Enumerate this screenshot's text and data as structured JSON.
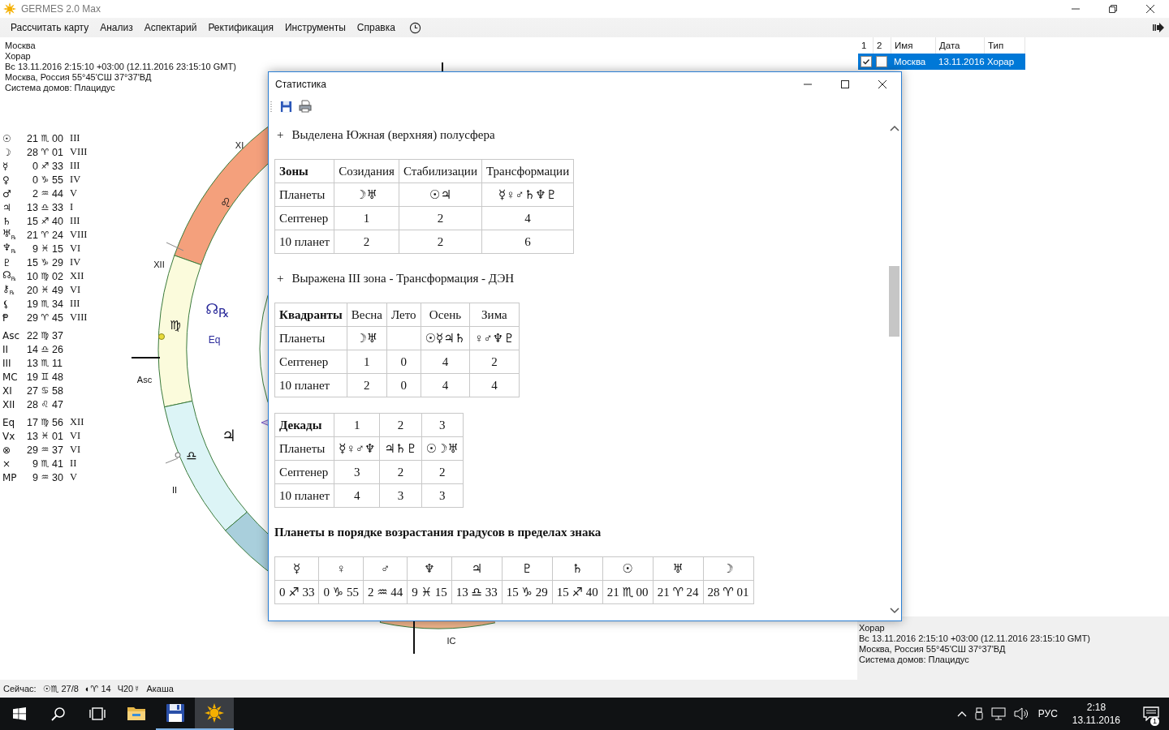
{
  "window": {
    "title": "GERMES 2.0 Max"
  },
  "menu": [
    "Рассчитать карту",
    "Анализ",
    "Аспектарий",
    "Ректификация",
    "Инструменты",
    "Справка"
  ],
  "chart_info": [
    "Москва",
    "Хорар",
    "Вс 13.11.2016 2:15:10 +03:00 (12.11.2016 23:15:10 GMT)",
    "Москва, Россия 55°45'СШ 37°37'ВД",
    "Система домов: Плацидус"
  ],
  "positions": [
    [
      {
        "glyph": "☉",
        "deg": "21",
        "sign": "♏",
        "min": "00",
        "house": "III"
      },
      {
        "glyph": "☽",
        "deg": "28",
        "sign": "♈",
        "min": "01",
        "house": "VIII"
      },
      {
        "glyph": "☿",
        "deg": "0",
        "sign": "♐",
        "min": "33",
        "house": "III"
      },
      {
        "glyph": "♀",
        "deg": "0",
        "sign": "♑",
        "min": "55",
        "house": "IV"
      },
      {
        "glyph": "♂",
        "deg": "2",
        "sign": "♒",
        "min": "44",
        "house": "V"
      },
      {
        "glyph": "♃",
        "deg": "13",
        "sign": "♎",
        "min": "33",
        "house": "I"
      },
      {
        "glyph": "♄",
        "deg": "15",
        "sign": "♐",
        "min": "40",
        "house": "III"
      },
      {
        "glyph": "♅$_{℞}$",
        "deg": "21",
        "sign": "♈",
        "min": "24",
        "house": "VIII"
      },
      {
        "glyph": "♆$_{℞}$",
        "deg": "9",
        "sign": "♓",
        "min": "15",
        "house": "VI"
      },
      {
        "glyph": "♇",
        "deg": "15",
        "sign": "♑",
        "min": "29",
        "house": "IV"
      },
      {
        "glyph": "☊$_{℞}$",
        "deg": "10",
        "sign": "♍",
        "min": "02",
        "house": "XII"
      },
      {
        "glyph": "⚷$_{℞}$",
        "deg": "20",
        "sign": "♓",
        "min": "49",
        "house": "VI"
      },
      {
        "glyph": "⚸",
        "deg": "19",
        "sign": "♏",
        "min": "34",
        "house": "III"
      },
      {
        "glyph": "Ᵽ",
        "deg": "29",
        "sign": "♈",
        "min": "45",
        "house": "VIII"
      }
    ],
    [
      {
        "glyph": "Asc",
        "deg": "22",
        "sign": "♍",
        "min": "37"
      },
      {
        "glyph": "II",
        "deg": "14",
        "sign": "♎",
        "min": "26"
      },
      {
        "glyph": "III",
        "deg": "13",
        "sign": "♏",
        "min": "11"
      },
      {
        "glyph": "MC",
        "deg": "19",
        "sign": "♊",
        "min": "48"
      },
      {
        "glyph": "XI",
        "deg": "27",
        "sign": "♋",
        "min": "58"
      },
      {
        "glyph": "XII",
        "deg": "28",
        "sign": "♌",
        "min": "47"
      }
    ],
    [
      {
        "glyph": "Eq",
        "deg": "17",
        "sign": "♍",
        "min": "56",
        "house": "XII"
      },
      {
        "glyph": "Vx",
        "deg": "13",
        "sign": "♓",
        "min": "01",
        "house": "VI"
      },
      {
        "glyph": "⊗",
        "deg": "29",
        "sign": "♒",
        "min": "37",
        "house": "VI"
      },
      {
        "glyph": "×",
        "deg": "9",
        "sign": "♏",
        "min": "41",
        "house": "II"
      },
      {
        "glyph": "MP",
        "deg": "9",
        "sign": "♒",
        "min": "30",
        "house": "V"
      }
    ]
  ],
  "chart_labels": [
    "XI",
    "XII",
    "Asc",
    "II",
    "IC",
    "♌",
    "♍",
    "♎",
    "☊$_{℞}$",
    "Eq",
    "♃"
  ],
  "charts_table": {
    "columns": [
      "1",
      "2",
      "Имя",
      "Дата",
      "Тип"
    ],
    "rows": [
      {
        "first": true,
        "second": false,
        "name": "Москва",
        "date": "13.11.2016",
        "type": "Хорар",
        "selected": true
      }
    ]
  },
  "details": [
    "Хорар",
    "Вс 13.11.2016 2:15:10 +03:00 (12.11.2016 23:15:10 GMT)",
    "Москва, Россия 55°45'СШ 37°37'ВД",
    "Система домов: Плацидус"
  ],
  "status_bar": {
    "label": "Сейчас:",
    "items": [
      "☉♏ 27/8",
      "◐♈ 14",
      "Ч20☿",
      "Акаша"
    ]
  },
  "dialog": {
    "title": "Статистика",
    "blocks": [
      {
        "kind": "note",
        "marker": "+",
        "text": "Выделена Южная (верхняя) полусфера"
      },
      {
        "kind": "table",
        "header": true,
        "rows": [
          [
            "Зоны",
            "Созидания",
            "Стабилизации",
            "Трансформации"
          ],
          [
            "Планеты",
            "☽♅",
            "☉♃",
            "☿♀♂♄♆♇"
          ],
          [
            "Септенер",
            "1",
            "2",
            "4"
          ],
          [
            "10 планет",
            "2",
            "2",
            "6"
          ]
        ]
      },
      {
        "kind": "note",
        "marker": "+",
        "text": "Выражена III зона - Трансформация - ДЭН"
      },
      {
        "kind": "table",
        "header": true,
        "rows": [
          [
            "Квадранты",
            "Весна",
            "Лето",
            "Осень",
            "Зима"
          ],
          [
            "Планеты",
            "☽♅",
            null,
            "☉☿♃♄",
            "♀♂♆♇"
          ],
          [
            "Септенер",
            "1",
            "0",
            "4",
            "2"
          ],
          [
            "10 планет",
            "2",
            "0",
            "4",
            "4"
          ]
        ]
      },
      {
        "kind": "table",
        "header": true,
        "rows": [
          [
            "Декады",
            "1",
            "2",
            "3"
          ],
          [
            "Планеты",
            "☿♀♂♆",
            "♃♄♇",
            "☉☽♅"
          ],
          [
            "Септенер",
            "3",
            "2",
            "2"
          ],
          [
            "10 планет",
            "4",
            "3",
            "3"
          ]
        ]
      },
      {
        "kind": "heading",
        "text": "Планеты в порядке возрастания градусов в пределах знака"
      },
      {
        "kind": "table",
        "header": false,
        "rows": [
          [
            "☿",
            "♀",
            "♂",
            "♆",
            "♃",
            "♇",
            "♄",
            "☉",
            "♅",
            "☽"
          ],
          [
            "0 ♐ 33",
            "0 ♑ 55",
            "2 ♒ 44",
            "9 ♓ 15",
            "13 ♎ 33",
            "15 ♑ 29",
            "15 ♐ 40",
            "21 ♏ 00",
            "21 ♈ 24",
            "28 ♈ 01"
          ]
        ]
      }
    ]
  },
  "taskbar": {
    "apps": [
      {
        "kind": "explorer",
        "running": false,
        "selected": false
      },
      {
        "kind": "floppy",
        "running": true,
        "selected": false
      },
      {
        "kind": "sun",
        "running": true,
        "selected": true
      }
    ],
    "language": "РУС",
    "time": "2:18",
    "date": "13.11.2016",
    "notifications": "1"
  }
}
